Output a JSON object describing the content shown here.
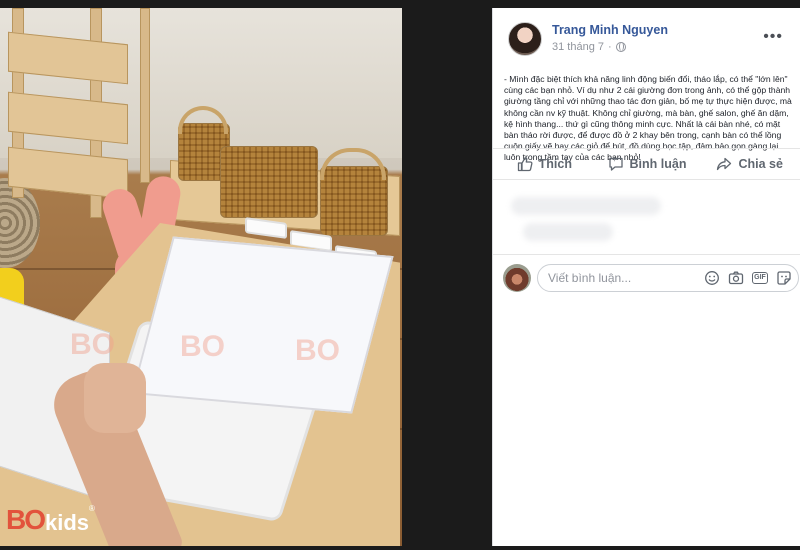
{
  "post": {
    "author": "Trang Minh Nguyen",
    "date": "31 tháng 7",
    "text": "- Mình đặc biệt thích khả năng linh động biến đổi, tháo lắp, có thể \"lớn lên\" cùng các bạn nhỏ. Ví dụ như 2 cái giường đơn trong ảnh, có thể gộp thành giường tầng chỉ với những thao tác đơn giản, bố mẹ tự thực hiện được, mà không cần nv kỹ thuật. Không chỉ giường, mà bàn, ghế salon, ghế ăn dặm, kệ hình thang... thứ gì cũng thông minh cực. Nhất là cái bàn nhé, có mặt bàn tháo rời được, để được đồ ở 2 khay bên trong, cạnh bàn có thể lồng cuộn giấy vẽ hay các giỏ để bút, đồ dùng học tập, đảm bảo gọn gàng lại luôn trong tầm tay của các bạn nhỏ!"
  },
  "actions": {
    "like": "Thích",
    "comment": "Bình luận",
    "share": "Chia sẻ"
  },
  "comment_box": {
    "placeholder": "Viết bình luận..."
  },
  "icons": {
    "more": "more-options-icon",
    "privacy": "globe-icon",
    "like": "thumbs-up-icon",
    "comment": "speech-bubble-icon",
    "share": "share-arrow-icon",
    "emoji": "smiley-icon",
    "camera": "camera-icon",
    "gif": "gif-icon",
    "sticker": "sticker-icon"
  },
  "photo": {
    "watermark": "BO",
    "logo_mark": "BO",
    "logo_text": "kids",
    "logo_reg": "®"
  },
  "colors": {
    "author_link": "#365899",
    "action_text": "#606770",
    "brand_red": "#e2533c"
  }
}
